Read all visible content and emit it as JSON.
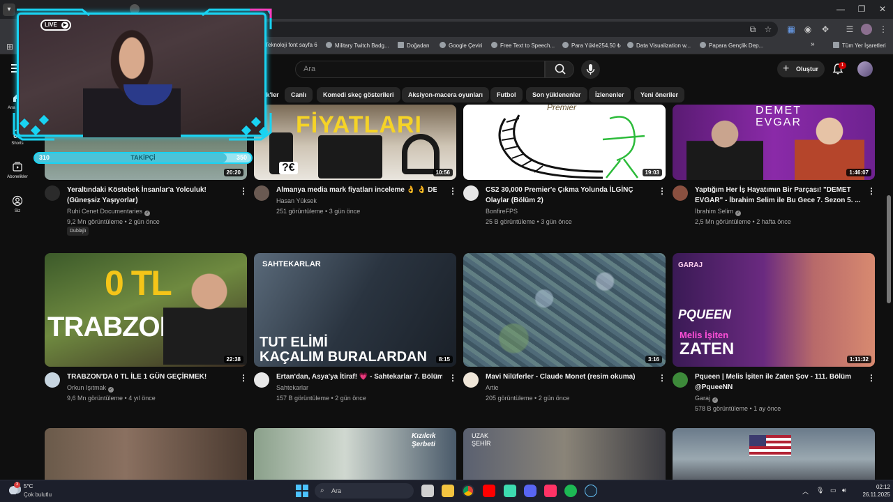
{
  "browser": {
    "bookmarks": [
      {
        "label": "Teknoloji font sayfa 6"
      },
      {
        "label": "Military Twitch Badg..."
      },
      {
        "label": "Doğadan"
      },
      {
        "label": "Google Çeviri"
      },
      {
        "label": "Free Text to Speech..."
      },
      {
        "label": "Para Yükle254.50 ₺"
      },
      {
        "label": "Data Visualization w..."
      },
      {
        "label": "Papara Gençlik Dep..."
      },
      {
        "label": "Tüm Yer İşaretleri"
      }
    ],
    "more_bookmarks": "»"
  },
  "header": {
    "search_placeholder": "Ara",
    "create_label": "Oluştur",
    "notification_count": "1"
  },
  "sidebar": {
    "items": [
      {
        "label": "Ana Sayfa"
      },
      {
        "label": "Shorts"
      },
      {
        "label": "Abonelikler"
      },
      {
        "label": "Siz"
      }
    ]
  },
  "chips": [
    {
      "label": "...k'ler"
    },
    {
      "label": "Canlı"
    },
    {
      "label": "Komedi skeç gösterileri"
    },
    {
      "label": "Aksiyon-macera oyunları"
    },
    {
      "label": "Futbol"
    },
    {
      "label": "Son yüklenenler"
    },
    {
      "label": "İzlenenler"
    },
    {
      "label": "Yeni öneriler"
    }
  ],
  "videos": [
    {
      "title": "Yeraltındaki Köstebek İnsanlar'a Yolculuk! (Güneşsiz Yaşıyorlar)",
      "channel": "Ruhi Cenet Documentaries",
      "meta": "9,2 Mn görüntüleme • 2 gün önce",
      "duration": "20:20",
      "badge": "Dublajlı"
    },
    {
      "title": "Almanya media mark fiyatları inceleme 👌 👌 DE",
      "channel": "Hasan Yüksek",
      "meta": "251 görüntüleme • 3 gün önce",
      "duration": "10:56",
      "thumb_text": "FİYATLARI",
      "price_tag": "?€"
    },
    {
      "title": "CS2 30,000 Premier'e Çıkma Yolunda İLGİNÇ Olaylar (Bölüm 2)",
      "channel": "BonfireFPS",
      "meta": "25 B görüntüleme • 3 gün önce",
      "duration": "19:03",
      "thumb_text": "Premier"
    },
    {
      "title": "Yaptığım Her İş Hayatımın Bir Parçası! \"DEMET EVGAR\" - İbrahim Selim ile Bu Gece 7. Sezon 5. ...",
      "channel": "İbrahim Selim",
      "meta": "2,5 Mn görüntüleme • 2 hafta önce",
      "duration": "1:46:07",
      "thumb_text": "DEMET EVGAR"
    },
    {
      "title": "TRABZON'DA 0 TL İLE 1 GÜN GEÇİRMEK!",
      "channel": "Orkun Işıtmak",
      "meta": "9,6 Mn görüntüleme • 4 yıl önce",
      "duration": "22:38",
      "thumb_text_1": "0 TL",
      "thumb_text_2": "TRABZON"
    },
    {
      "title": "Ertan'dan, Asya'ya İtiraf! 💗 - Sahtekarlar 7. Bölüm",
      "channel": "Sahtekarlar",
      "meta": "157 B görüntüleme • 2 gün önce",
      "duration": "8:15",
      "thumb_text_1": "SAHTEKARLAR",
      "thumb_text_2": "TUT ELİMİ",
      "thumb_text_3": "KAÇALIM BURALARDAN"
    },
    {
      "title": "Mavi Nilüferler - Claude Monet (resim okuma)",
      "channel": "Artie",
      "meta": "205 görüntüleme • 2 gün önce",
      "duration": "3:16"
    },
    {
      "title": "Pqueen | Melis İşiten ile Zaten Şov - 111. Bölüm @PqueeNN",
      "channel": "Garaj",
      "meta": "578 B görüntüleme • 1 ay önce",
      "duration": "1:11:32",
      "thumb_text_1": "GARAJ",
      "thumb_text_2": "PQUEEN",
      "thumb_text_3": "Melis İşiten",
      "thumb_text_4": "ZATEN"
    }
  ],
  "bottom_row_thumbs": [
    {
      "thumb_text": ""
    },
    {
      "thumb_text": "Kızılcık Şerbeti"
    },
    {
      "thumb_text": "UZAK ŞEHİR"
    },
    {
      "thumb_text": ""
    }
  ],
  "stream_overlay": {
    "live_label": "LIVE",
    "follower_label": "TAKİPÇİ",
    "follower_current": "310",
    "follower_goal": "350",
    "progress_fraction": 0.886,
    "accent_color": "#19d3f2"
  },
  "taskbar": {
    "weather_temp": "5°C",
    "weather_desc": "Çok bulutlu",
    "search_placeholder": "Ara",
    "time": "02:12",
    "date": "26.11.2025",
    "weather_alert": "3"
  },
  "colors": {
    "background": "#0f0f0f",
    "chip_bg": "#272727",
    "brand_red": "#ff0000"
  }
}
